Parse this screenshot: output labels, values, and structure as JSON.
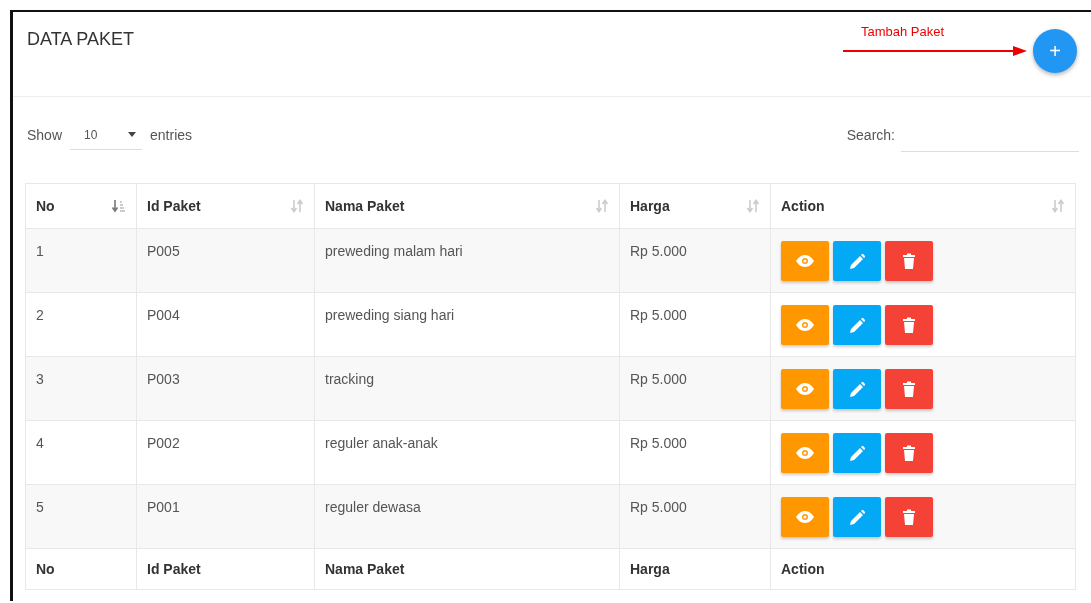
{
  "panel": {
    "title": "DATA PAKET",
    "annotation": "Tambah Paket",
    "add_button": "+"
  },
  "length_control": {
    "label_before": "Show",
    "value": "10",
    "label_after": "entries"
  },
  "search": {
    "label": "Search:"
  },
  "table": {
    "columns": [
      {
        "label": "No",
        "sorted": true
      },
      {
        "label": "Id Paket",
        "sorted": false
      },
      {
        "label": "Nama Paket",
        "sorted": false
      },
      {
        "label": "Harga",
        "sorted": false
      },
      {
        "label": "Action",
        "sorted": false
      }
    ],
    "rows": [
      {
        "no": "1",
        "id": "P005",
        "nama": "preweding malam hari",
        "harga": "Rp 5.000"
      },
      {
        "no": "2",
        "id": "P004",
        "nama": "preweding siang hari",
        "harga": "Rp 5.000"
      },
      {
        "no": "3",
        "id": "P003",
        "nama": "tracking",
        "harga": "Rp 5.000"
      },
      {
        "no": "4",
        "id": "P002",
        "nama": "reguler anak-anak",
        "harga": "Rp 5.000"
      },
      {
        "no": "5",
        "id": "P001",
        "nama": "reguler dewasa",
        "harga": "Rp 5.000"
      }
    ],
    "footer": [
      "No",
      "Id Paket",
      "Nama Paket",
      "Harga",
      "Action"
    ]
  }
}
